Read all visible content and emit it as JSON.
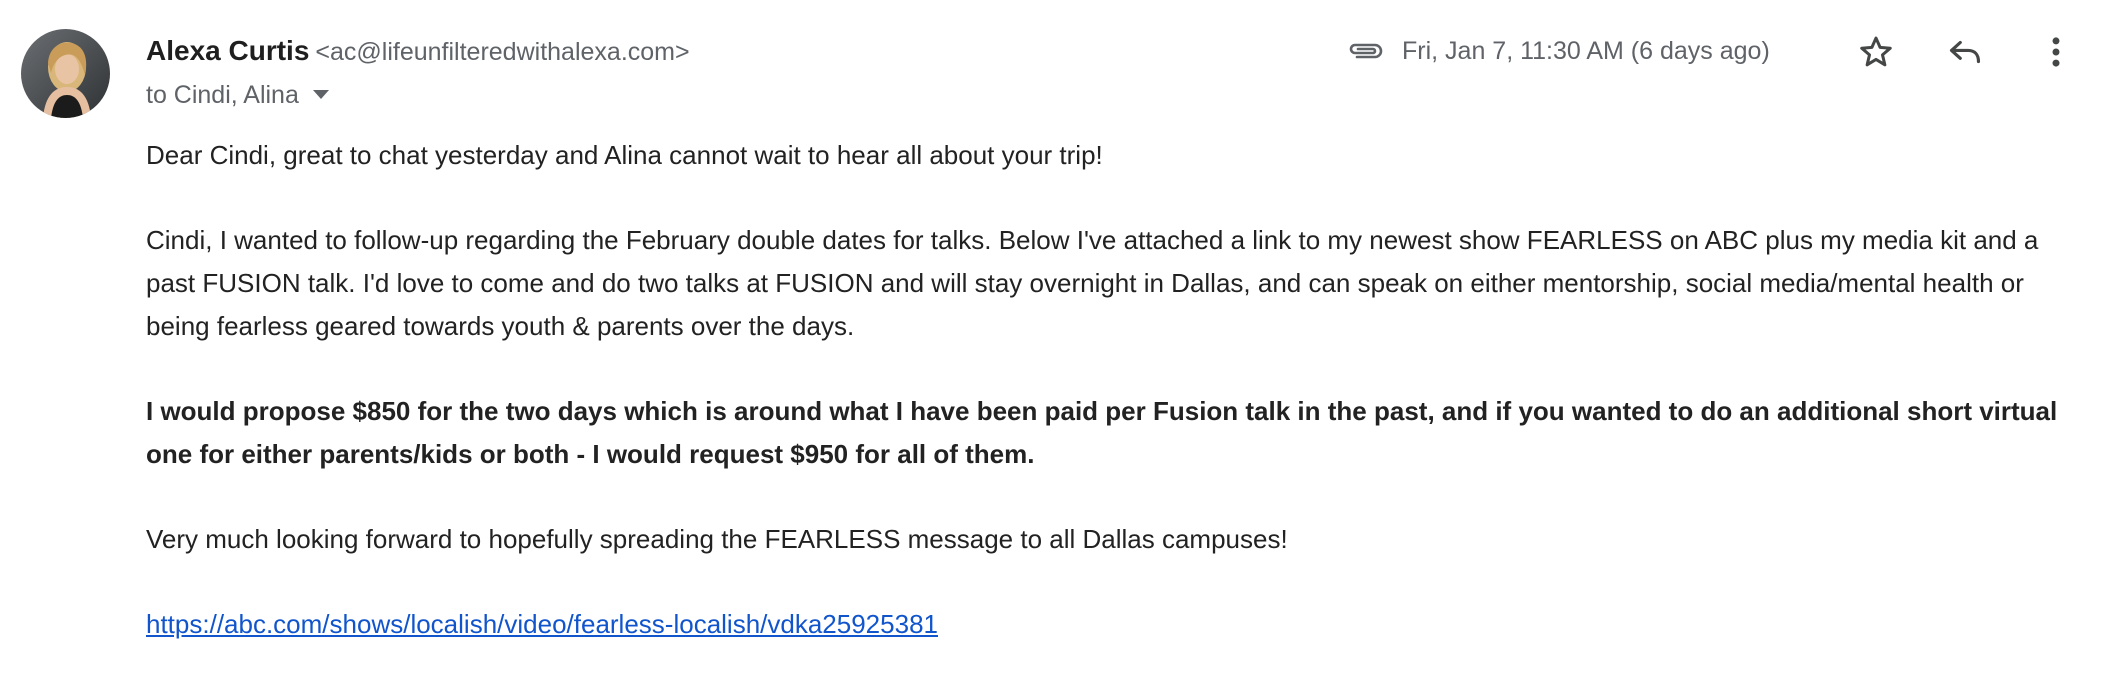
{
  "sender": {
    "name": "Alexa Curtis",
    "email": "<ac@lifeunfilteredwithalexa.com>"
  },
  "recipients": {
    "label": "to Cindi, Alina"
  },
  "meta": {
    "date": "Fri, Jan 7, 11:30 AM (6 days ago)",
    "attachment_icon": "paperclip-icon",
    "star_icon": "star-outline-icon",
    "reply_icon": "reply-icon",
    "more_icon": "more-vert-icon"
  },
  "body": {
    "p1": "Dear Cindi, great to chat yesterday and Alina cannot wait to hear all about your trip!",
    "p2": "Cindi, I wanted to follow-up regarding the February double dates for talks.  Below I've attached a link to my newest show FEARLESS on ABC plus my media kit and a past FUSION talk. I'd love to come and do two talks at FUSION and will stay overnight in Dallas, and can speak on either mentorship, social media/mental health or being fearless geared towards youth & parents over the days.",
    "p3": "I would propose $850 for the two days which is around what I have been paid per Fusion talk in the past, and if you wanted to do an additional short virtual one for either parents/kids or both - I would request $950 for all of them.",
    "p4": "Very much looking forward to hopefully spreading the FEARLESS message to all Dallas campuses!",
    "link": "https://abc.com/shows/localish/video/fearless-localish/vdka25925381"
  },
  "colors": {
    "link": "#1155cc",
    "muted": "#5f6368",
    "text": "#222222"
  }
}
